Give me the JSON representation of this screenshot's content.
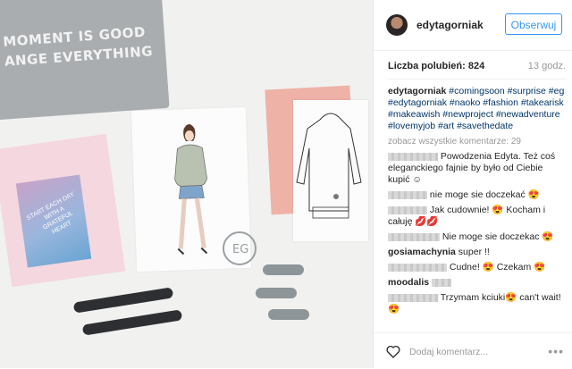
{
  "post": {
    "shirt_line1": "MOMENT IS GOOD",
    "shirt_line2": "ANGE EVERYTHING",
    "card_text": "START EACH DAY WITH A GRATEFUL HEART"
  },
  "panel": {
    "username": "edytagorniak",
    "follow_label": "Obserwuj",
    "likes_label": "Liczba polubień: 824",
    "time": "13 godz.",
    "caption_user": "edytagorniak",
    "caption_tags": [
      "#comingsoon",
      "#surprise",
      "#eg",
      "#edytagorniak",
      "#naoko",
      "#fashion",
      "#takearisk",
      "#makeawish",
      "#newproject",
      "#newadventure",
      "#lovemyjob",
      "#art",
      "#savethedate"
    ],
    "more_comments": "zobacz wszystkie komentarze: 29",
    "comments": [
      {
        "user": "",
        "text": "Powodzenia Edyta. Też coś eleganckiego fajnie by było od Ciebie kupić ☺"
      },
      {
        "user": "",
        "text": "nie moge sie doczekać 😍"
      },
      {
        "user": "",
        "text": "Jak cudownie! 😍 Kocham i całuję 💋💋"
      },
      {
        "user": "",
        "text": "Nie moge sie doczekac 😍"
      },
      {
        "user": "gosiamachynia",
        "text": "super !!"
      },
      {
        "user": "",
        "text": "Cudne! 😍 Czekam 😍"
      },
      {
        "user": "moodalis",
        "text": ""
      },
      {
        "user": "",
        "text": "Trzymam kciuki😍 can't wait!😍"
      }
    ],
    "add_comment_placeholder": "Dodaj komentarz...",
    "more_icon": "•••"
  },
  "icons": [
    "heart-icon",
    "ellipsis-icon"
  ]
}
